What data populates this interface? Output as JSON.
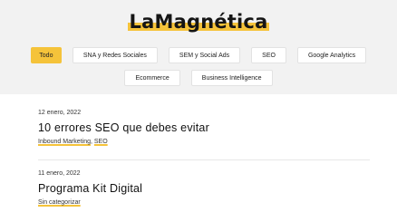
{
  "site": {
    "logo_text": "LaMagnética"
  },
  "filters": {
    "row1": [
      "Todo",
      "SNA y Redes Sociales",
      "SEM y Social Ads",
      "SEO",
      "Google Analytics"
    ],
    "row2": [
      "Ecommerce",
      "Business Intelligence"
    ],
    "active": "Todo"
  },
  "posts": [
    {
      "date": "12 enero, 2022",
      "title": "10 errores SEO que debes evitar",
      "categories": [
        "Inbound Marketing",
        "SEO"
      ],
      "separator": ", "
    },
    {
      "date": "11 enero, 2022",
      "title": "Programa Kit Digital",
      "categories": [
        "Sin categorizar"
      ]
    }
  ],
  "colors": {
    "accent": "#f5c33a",
    "header_bg": "#f2f2f2"
  }
}
